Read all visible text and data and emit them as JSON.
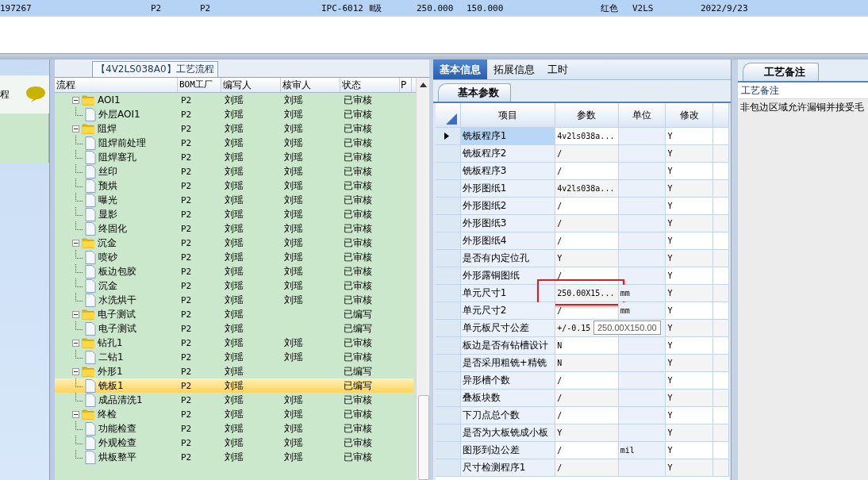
{
  "top_row": {
    "selected": true,
    "cells": [
      "197267",
      "P2",
      "P2",
      "IPC-6012 Ⅱ级",
      "250.000",
      "150.000",
      "红色",
      "V2LS",
      "2022/9/23"
    ]
  },
  "left_panel": {
    "title": "程"
  },
  "flow": {
    "title": "【4V2LS038A0】工艺流程",
    "columns": [
      "流程",
      "BOM工厂",
      "编写人",
      "核审人",
      "状态",
      "P"
    ],
    "rows": [
      {
        "name": "AOI1",
        "factory": "P2",
        "writer": "刘瑶",
        "reviewer": "刘瑶",
        "status": "已审核",
        "expanded": true,
        "selected": false,
        "children": [
          {
            "name": "外层AOI1",
            "factory": "P2",
            "writer": "刘瑶",
            "reviewer": "刘瑶",
            "status": "已审核",
            "selected": false
          }
        ]
      },
      {
        "name": "阻焊",
        "factory": "P2",
        "writer": "刘瑶",
        "reviewer": "刘瑶",
        "status": "已审核",
        "expanded": true,
        "selected": false,
        "children": [
          {
            "name": "阻焊前处理",
            "factory": "P2",
            "writer": "刘瑶",
            "reviewer": "刘瑶",
            "status": "已审核",
            "selected": false
          },
          {
            "name": "阻焊塞孔",
            "factory": "P2",
            "writer": "刘瑶",
            "reviewer": "刘瑶",
            "status": "已审核",
            "selected": false
          },
          {
            "name": "丝印",
            "factory": "P2",
            "writer": "刘瑶",
            "reviewer": "刘瑶",
            "status": "已审核",
            "selected": false
          },
          {
            "name": "预烘",
            "factory": "P2",
            "writer": "刘瑶",
            "reviewer": "刘瑶",
            "status": "已审核",
            "selected": false
          },
          {
            "name": "曝光",
            "factory": "P2",
            "writer": "刘瑶",
            "reviewer": "刘瑶",
            "status": "已审核",
            "selected": false
          },
          {
            "name": "显影",
            "factory": "P2",
            "writer": "刘瑶",
            "reviewer": "刘瑶",
            "status": "已审核",
            "selected": false
          },
          {
            "name": "终固化",
            "factory": "P2",
            "writer": "刘瑶",
            "reviewer": "刘瑶",
            "status": "已审核",
            "selected": false
          }
        ]
      },
      {
        "name": "沉金",
        "factory": "P2",
        "writer": "刘瑶",
        "reviewer": "刘瑶",
        "status": "已审核",
        "expanded": true,
        "selected": false,
        "children": [
          {
            "name": "喷砂",
            "factory": "P2",
            "writer": "刘瑶",
            "reviewer": "刘瑶",
            "status": "已审核",
            "selected": false
          },
          {
            "name": "板边包胶",
            "factory": "P2",
            "writer": "刘瑶",
            "reviewer": "刘瑶",
            "status": "已审核",
            "selected": false
          },
          {
            "name": "沉金",
            "factory": "P2",
            "writer": "刘瑶",
            "reviewer": "刘瑶",
            "status": "已审核",
            "selected": false
          },
          {
            "name": "水洗烘干",
            "factory": "P2",
            "writer": "刘瑶",
            "reviewer": "刘瑶",
            "status": "已审核",
            "selected": false
          }
        ]
      },
      {
        "name": "电子测试",
        "factory": "P2",
        "writer": "刘瑶",
        "status": "已编写",
        "expanded": true,
        "selected": false,
        "children": [
          {
            "name": "电子测试",
            "factory": "P2",
            "writer": "刘瑶",
            "status": "已编写",
            "selected": false
          }
        ]
      },
      {
        "name": "钻孔1",
        "factory": "P2",
        "writer": "刘瑶",
        "reviewer": "刘瑶",
        "status": "已审核",
        "expanded": true,
        "selected": false,
        "children": [
          {
            "name": "二钻1",
            "factory": "P2",
            "writer": "刘瑶",
            "reviewer": "刘瑶",
            "status": "已审核",
            "selected": false
          }
        ]
      },
      {
        "name": "外形1",
        "factory": "P2",
        "writer": "刘瑶",
        "status": "已编写",
        "expanded": true,
        "selected": false,
        "children": [
          {
            "name": "铣板1",
            "factory": "P2",
            "writer": "刘瑶",
            "status": "已编写",
            "selected": true
          },
          {
            "name": "成品清洗1",
            "factory": "P2",
            "writer": "刘瑶",
            "reviewer": "刘瑶",
            "status": "已审核",
            "selected": false
          }
        ]
      },
      {
        "name": "终检",
        "factory": "P2",
        "writer": "刘瑶",
        "reviewer": "刘瑶",
        "status": "已审核",
        "expanded": true,
        "selected": false,
        "children": [
          {
            "name": "功能检查",
            "factory": "P2",
            "writer": "刘瑶",
            "reviewer": "刘瑶",
            "status": "已审核",
            "selected": false
          },
          {
            "name": "外观检查",
            "factory": "P2",
            "writer": "刘瑶",
            "reviewer": "刘瑶",
            "status": "已审核",
            "selected": false
          },
          {
            "name": "烘板整平",
            "factory": "P2",
            "writer": "刘瑶",
            "reviewer": "刘瑶",
            "status": "已审核",
            "selected": false
          }
        ]
      }
    ]
  },
  "detail": {
    "tabs": [
      {
        "label": "基本信息",
        "selected": true
      },
      {
        "label": "拓展信息",
        "selected": false
      },
      {
        "label": "工时",
        "selected": false
      }
    ],
    "subtab": "基本参数",
    "columns": [
      "项目",
      "参数",
      "单位",
      "修改"
    ],
    "tooltip": "250.00X150.00",
    "rows": [
      {
        "item": "铣板程序1",
        "param": "4v2ls038a...",
        "modify": "Y",
        "current": true,
        "highlighted": false
      },
      {
        "item": "铣板程序2",
        "param": "/",
        "modify": "Y",
        "current": false,
        "highlighted": false
      },
      {
        "item": "铣板程序3",
        "param": "/",
        "modify": "Y",
        "current": false,
        "highlighted": false
      },
      {
        "item": "外形图纸1",
        "param": "4v2ls038a...",
        "modify": "Y",
        "current": false,
        "highlighted": false
      },
      {
        "item": "外形图纸2",
        "param": "/",
        "modify": "Y",
        "current": false,
        "highlighted": false
      },
      {
        "item": "外形图纸3",
        "param": "/",
        "modify": "Y",
        "current": false,
        "highlighted": false
      },
      {
        "item": "外形图纸4",
        "param": "/",
        "modify": "Y",
        "current": false,
        "highlighted": false
      },
      {
        "item": "是否有内定位孔",
        "param": "Y",
        "modify": "Y",
        "current": false,
        "highlighted": false
      },
      {
        "item": "外形露铜图纸",
        "param": "/",
        "modify": "Y",
        "current": false,
        "highlighted": false
      },
      {
        "item": "单元尺寸1",
        "param": "250.00X15...",
        "unit": "mm",
        "modify": "Y",
        "current": false,
        "highlighted": true
      },
      {
        "item": "单元尺寸2",
        "param": "/",
        "unit": "mm",
        "modify": "Y",
        "current": false,
        "highlighted": false
      },
      {
        "item": "单元板尺寸公差",
        "param": "+/-0.15",
        "modify": "Y",
        "current": false,
        "highlighted": false
      },
      {
        "item": "板边是否有钻槽设计",
        "param": "N",
        "modify": "Y",
        "current": false,
        "highlighted": false
      },
      {
        "item": "是否采用粗铣+精铣",
        "param": "N",
        "modify": "Y",
        "current": false,
        "highlighted": false
      },
      {
        "item": "异形槽个数",
        "param": "/",
        "modify": "Y",
        "current": false,
        "highlighted": false
      },
      {
        "item": "叠板块数",
        "param": "/",
        "modify": "Y",
        "current": false,
        "highlighted": false
      },
      {
        "item": "下刀点总个数",
        "param": "/",
        "modify": "Y",
        "current": false,
        "highlighted": false
      },
      {
        "item": "是否为大板铣成小板",
        "param": "Y",
        "modify": "Y",
        "current": false,
        "highlighted": false
      },
      {
        "item": "图形到边公差",
        "param": "/",
        "unit": "mil",
        "modify": "Y",
        "current": false,
        "highlighted": false
      },
      {
        "item": "尺寸检测程序1",
        "param": "/",
        "modify": "Y",
        "current": false,
        "highlighted": false
      }
    ]
  },
  "remarks": {
    "tab": "工艺备注",
    "header": "工艺备注",
    "text": "非包边区域允许漏铜并接受毛"
  }
}
